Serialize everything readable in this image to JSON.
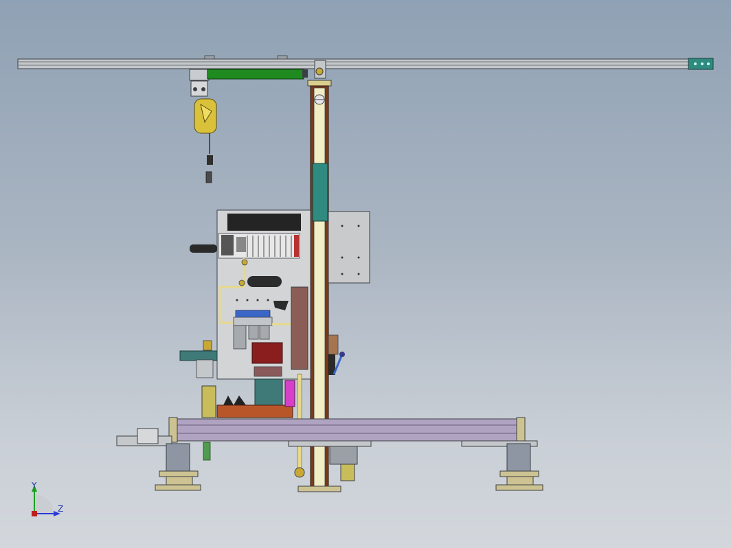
{
  "viewport": {
    "background_top": "#8fa1b4",
    "background_bottom": "#d3d7dc"
  },
  "model": {
    "components": [
      "overhead-rail",
      "linear-actuator",
      "spring-balancer",
      "vertical-column",
      "pneumatic-control-panel",
      "electrical-cabinet",
      "base-frame",
      "leveling-feet"
    ],
    "colors": {
      "rail": "#b9bcc0",
      "actuator": "#1f8a1f",
      "balancer": "#d9c23a",
      "column_outer": "#7a3a1a",
      "column_inner": "#f1edc4",
      "column_band": "#2f8a80",
      "panel": "#d2d4d6",
      "cabinet": "#c9cacb",
      "frame": "#b0a3c2",
      "feet": "#cdc392",
      "valve": "#3a66c8",
      "pipe": "#e8d98a",
      "magenta_part": "#d640c8"
    }
  },
  "triad": {
    "y_label": "Y",
    "z_label": "Z",
    "y_color": "#19a01f",
    "z_color": "#2a3ad8"
  }
}
